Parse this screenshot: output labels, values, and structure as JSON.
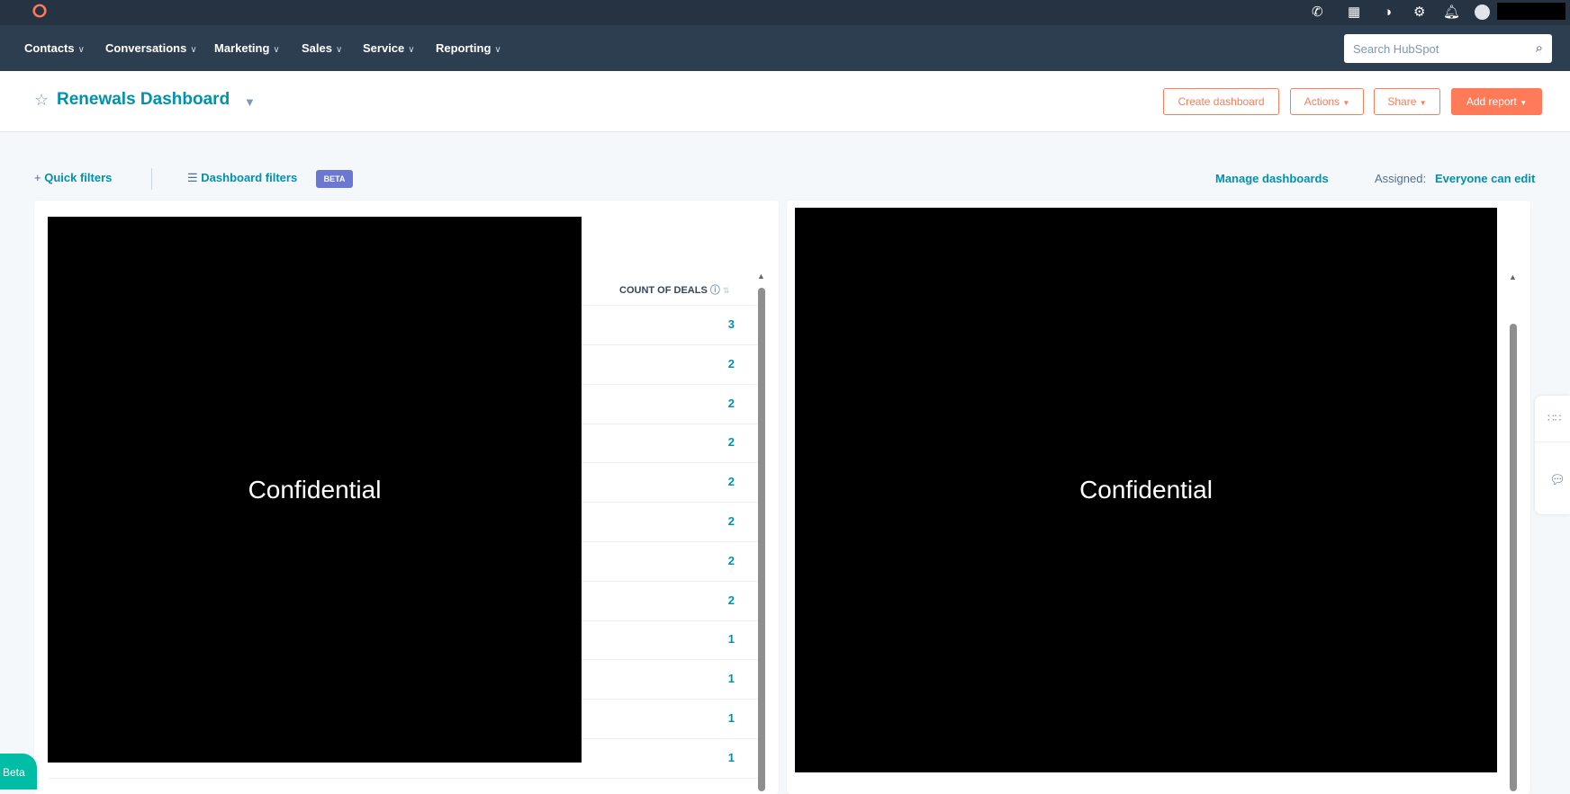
{
  "topbar": {
    "icons": [
      "calling-icon",
      "marketplace-icon",
      "help-icon",
      "settings-icon",
      "notifications-icon",
      "avatar"
    ]
  },
  "nav": {
    "items": [
      "Contacts",
      "Conversations",
      "Marketing",
      "Sales",
      "Service",
      "Reporting"
    ],
    "search_placeholder": "Search HubSpot"
  },
  "header": {
    "title": "Renewals Dashboard",
    "buttons": {
      "create": "Create dashboard",
      "actions": "Actions",
      "share": "Share",
      "add_report": "Add report"
    }
  },
  "filters": {
    "quick": "Quick filters",
    "dashboard": "Dashboard filters",
    "beta": "BETA",
    "manage": "Manage dashboards",
    "assigned_label": "Assigned:",
    "assigned_value": "Everyone can edit"
  },
  "left_report": {
    "redacted": "Confidential",
    "column": "COUNT OF DEALS",
    "values": [
      "3",
      "2",
      "2",
      "2",
      "2",
      "2",
      "2",
      "2",
      "1",
      "1",
      "1",
      "1"
    ]
  },
  "right_report": {
    "redacted": "Confidential"
  },
  "beta_bubble": "Beta",
  "colors": {
    "accent": "#0091ae",
    "orange": "#ff7a59",
    "nav": "#2d3e50"
  }
}
